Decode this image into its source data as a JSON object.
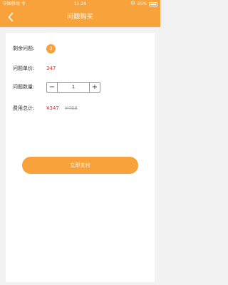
{
  "status_bar": {
    "carrier": "中国移动 令",
    "time": "11:26",
    "battery_percent": "85%",
    "indicators": [
      "alarm-icon",
      "battery-icon"
    ]
  },
  "header": {
    "back_icon": "chevron-left-icon",
    "title": "问题购买"
  },
  "order": {
    "remaining": {
      "label": "剩余问题:",
      "value": "3"
    },
    "unit_price": {
      "label": "问题单价:",
      "value": "347"
    },
    "quantity": {
      "label": "问题数量:",
      "value": "1",
      "minus_icon": "minus-icon",
      "plus_icon": "plus-icon"
    },
    "total": {
      "label": "费用总计:",
      "current": "¥347",
      "original": "¥488"
    }
  },
  "actions": {
    "pay_button_label": "立即支付"
  },
  "colors": {
    "accent": "#f7a23b",
    "price_red": "#ea2b2b",
    "strike_gray": "#a9a9a9",
    "background": "#f2f2f2",
    "card": "#ffffff"
  }
}
